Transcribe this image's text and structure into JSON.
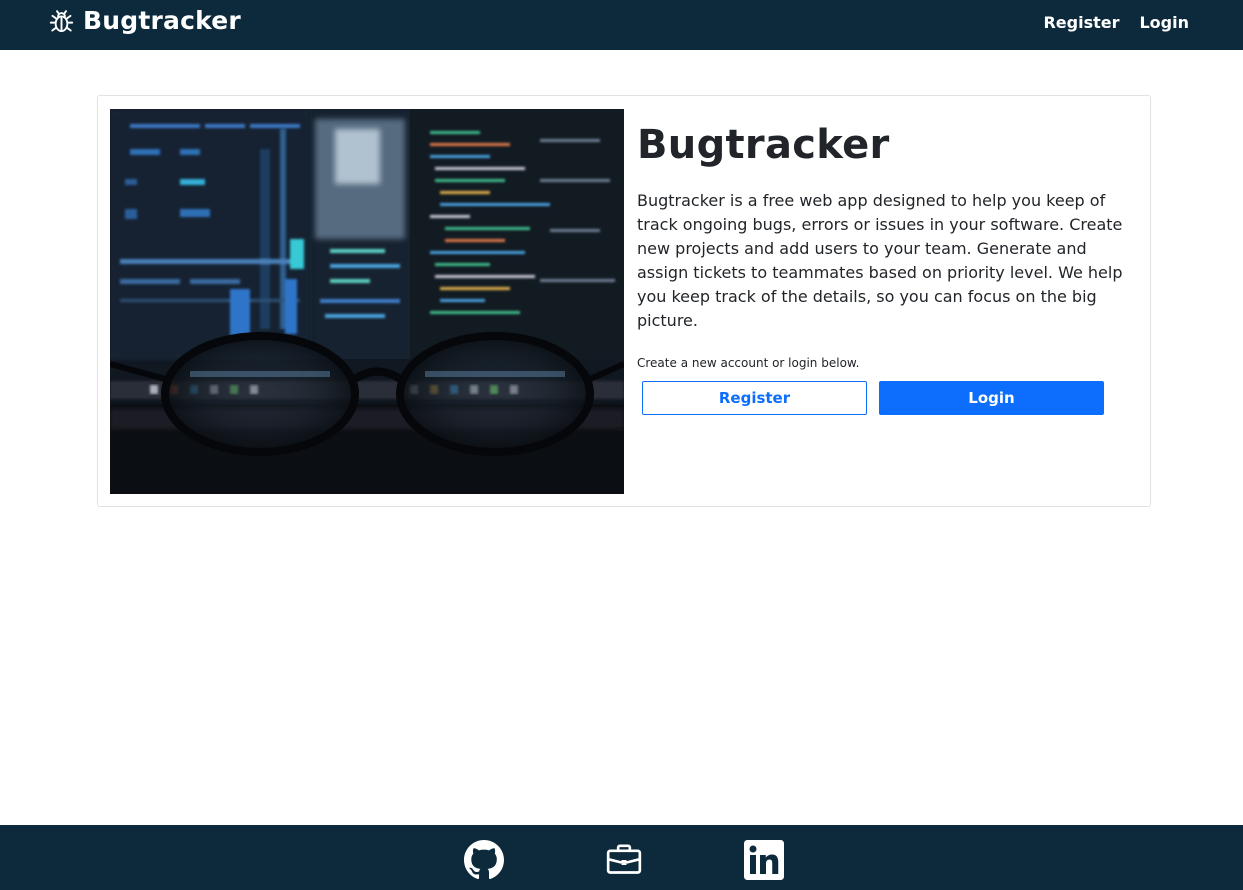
{
  "navbar": {
    "brand": "Bugtracker",
    "brand_icon": "bug-icon",
    "links": [
      "Register",
      "Login"
    ]
  },
  "hero": {
    "image_description_icon": "code-screen-glasses-image",
    "title": "Bugtracker",
    "description": "Bugtracker is a free web app designed to help you keep of track ongoing bugs, errors or issues in your software. Create new projects and add users to your team. Generate and assign tickets to teammates based on priority level. We help you keep track of the details, so you can focus on the big picture.",
    "hint": "Create a new account or login below.",
    "register_label": "Register",
    "login_label": "Login"
  },
  "footer": {
    "icons": [
      "github-icon",
      "briefcase-icon",
      "linkedin-icon"
    ]
  },
  "colors": {
    "navbar_bg": "#0d2a3d",
    "primary": "#0d6efd",
    "card_border": "#dfe2e6"
  }
}
